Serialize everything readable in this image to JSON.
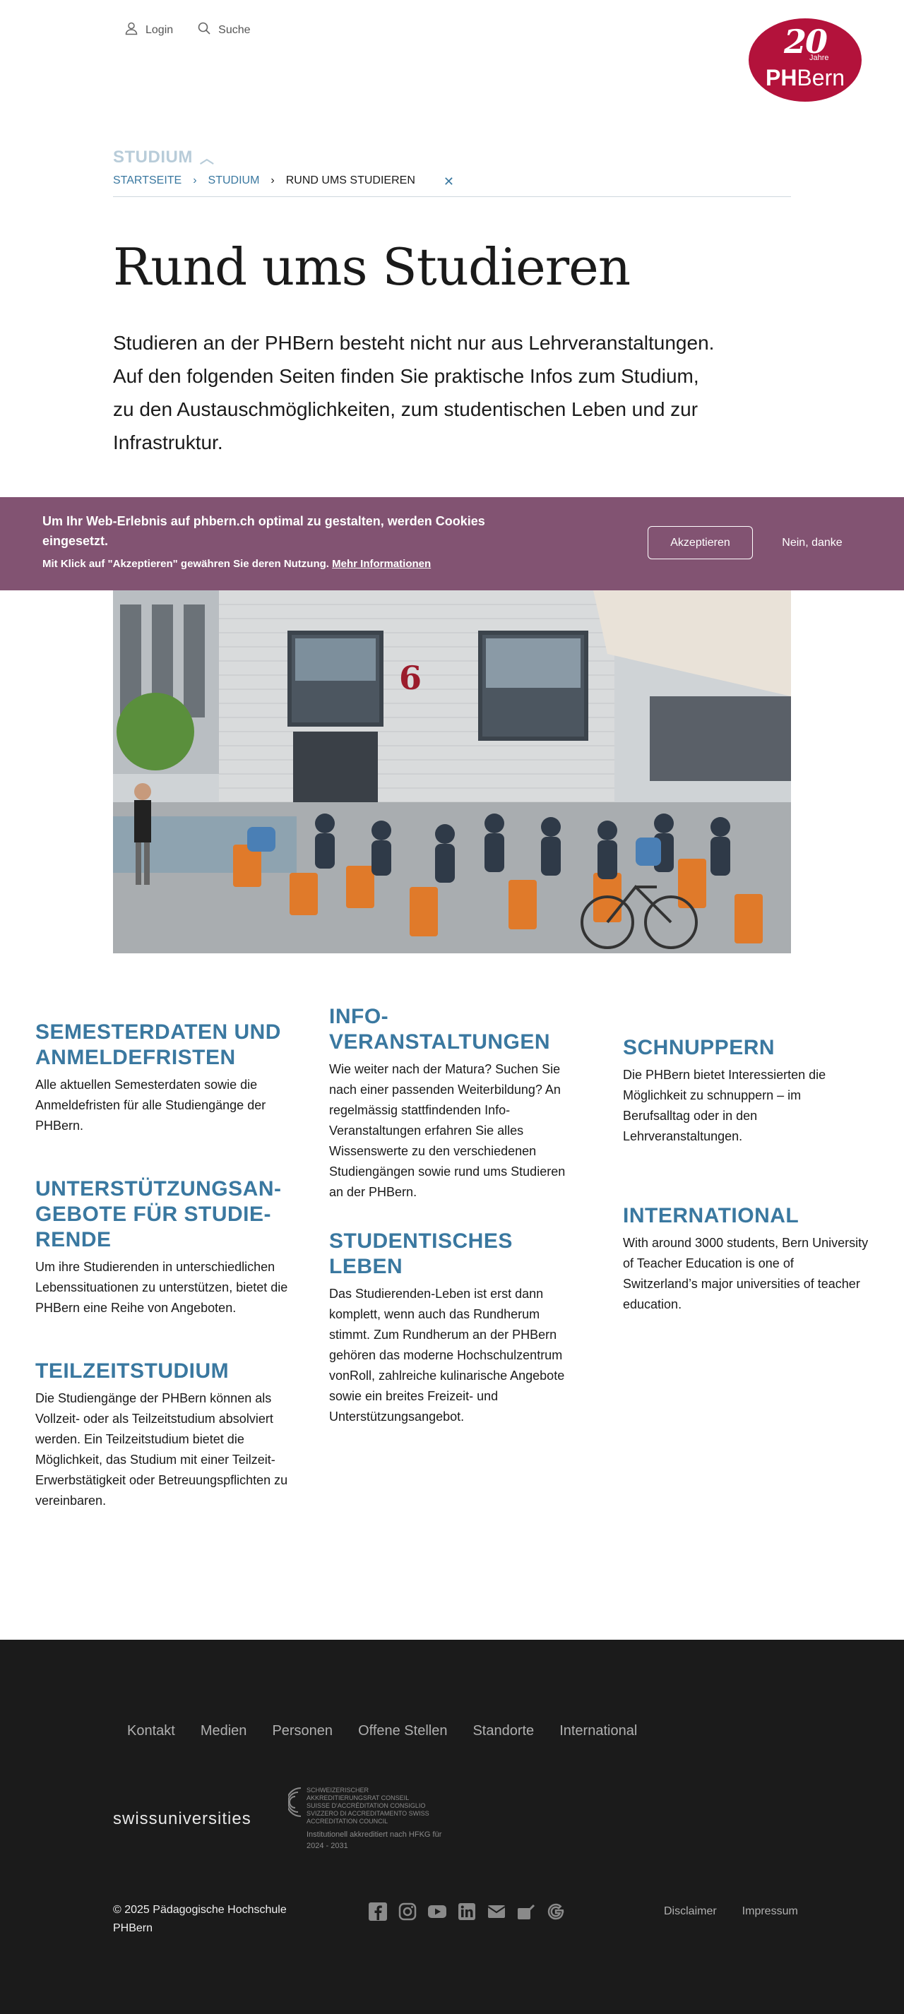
{
  "topbar": {
    "login": "Login",
    "search": "Suche"
  },
  "logo": {
    "anniversary": "20",
    "jahre": "Jahre",
    "brand_bold": "PH",
    "brand_light": "Bern"
  },
  "section": {
    "label": "STUDIUM"
  },
  "breadcrumb": {
    "home": "STARTSEITE",
    "parent": "STUDIUM",
    "current": "RUND UMS STUDIEREN",
    "close": "✕"
  },
  "page": {
    "title": "Rund ums Studieren",
    "intro": "Studieren an der PHBern besteht nicht nur aus Lehrveranstaltungen. Auf den folgenden Seiten finden Sie praktische Infos zum Studium, zu den Austauschmöglichkeiten, zum studentischen Leben und zur Infrastruktur."
  },
  "cookie": {
    "message": "Um Ihr Web-Erlebnis auf phbern.ch optimal zu gestalten, werden Cookies eingesetzt.",
    "sub_text": "Mit Klick auf \"Akzeptieren\" gewähren Sie deren Nutzung.",
    "more_link": "Mehr Informationen",
    "accept": "Akzeptieren",
    "decline": "Nein, danke"
  },
  "hero": {
    "building_number": "6"
  },
  "cards": {
    "semester": {
      "title": "SEMESTERDATEN UND ANMELDEFRISTEN",
      "text": "Alle aktuellen Semesterdaten sowie die Anmeldefristen für alle Studiengänge der PHBern."
    },
    "support": {
      "title": "UNTERSTÜTZUNGSAN-GEBOTE FÜR STUDIE-RENDE",
      "text": "Um ihre Studierenden in unterschiedlichen Lebenssituationen zu unterstützen, bietet die PHBern eine Reihe von Angeboten."
    },
    "parttime": {
      "title": "TEILZEITSTUDIUM",
      "text": "Die Studiengänge der PHBern können als Vollzeit- oder als Teilzeitstudium absolviert werden. Ein Teilzeitstudium bietet die Möglichkeit, das Studium mit einer Teilzeit-Erwerbstätigkeit oder Betreuungspflichten zu vereinbaren."
    },
    "info": {
      "title": "INFO-VERANSTALTUNGEN",
      "text": "Wie weiter nach der Matura? Suchen Sie nach einer passenden Weiterbildung? An regelmässig stattfindenden Info-Veranstaltungen erfahren Sie alles Wissenswerte zu den verschiedenen Studiengängen sowie rund ums Studieren an der PHBern."
    },
    "student_life": {
      "title": "STUDENTISCHES LEBEN",
      "text": "Das Studierenden-Leben ist erst dann komplett, wenn auch das Rundherum stimmt. Zum Rundherum an der PHBern gehören das moderne Hochschulzentrum vonRoll, zahlreiche kulinarische Angebote sowie ein breites Freizeit- und Unterstützungsangebot."
    },
    "trial": {
      "title": "SCHNUPPERN",
      "text": "Die PHBern bietet Interessierten die Möglichkeit zu schnuppern – im Berufsalltag oder in den Lehrveranstaltungen."
    },
    "international": {
      "title": "INTERNATIONAL",
      "text": "With around 3000 students, Bern University of Teacher Education is one of Switzerland’s major universities of teacher education."
    }
  },
  "footer": {
    "nav": [
      "Kontakt",
      "Medien",
      "Personen",
      "Offene Stellen",
      "Standorte",
      "International"
    ],
    "swissuniversities": "swissuniversities",
    "accreditation_lines": "SCHWEIZERISCHER AKKREDITIERUNGSRAT CONSEIL SUISSE D'ACCRÉDITATION CONSIGLIO SVIZZERO DI ACCREDITAMENTO SWISS ACCREDITATION COUNCIL",
    "accreditation_note": "Institutionell akkreditiert nach HFKG für 2024 - 2031",
    "copyright": "© 2025 Pädagogische Hochschule PHBern",
    "social_icons": [
      "facebook-icon",
      "instagram-icon",
      "youtube-icon",
      "linkedin-icon",
      "newsletter-icon",
      "blog-icon",
      "google-icon"
    ],
    "legal": {
      "disclaimer": "Disclaimer",
      "impressum": "Impressum"
    }
  },
  "colors": {
    "brand_red": "#b3123b",
    "link_blue": "#3a78a0",
    "cookie_bg": "#825372",
    "footer_bg": "#1b1b1b"
  }
}
